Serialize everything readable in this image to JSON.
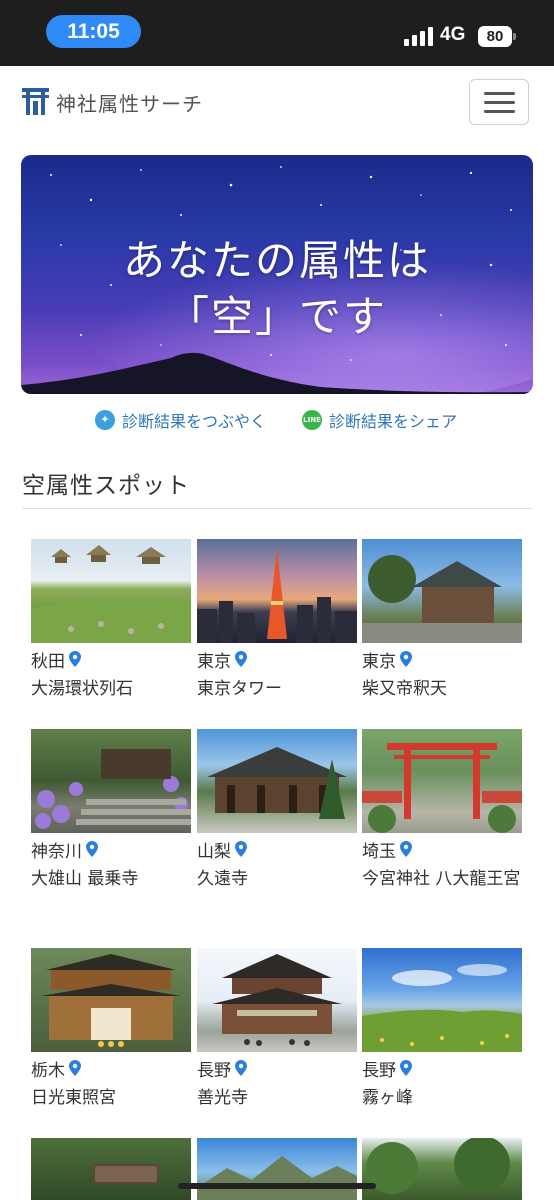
{
  "status_bar": {
    "time": "11:05",
    "network": "4G",
    "battery": "80"
  },
  "header": {
    "site_title": "神社属性サーチ"
  },
  "hero": {
    "line1": "あなたの属性は",
    "line2": "「空」です"
  },
  "share": {
    "twitter_label": "診断結果をつぶやく",
    "line_label": "診断結果をシェア",
    "line_icon_text": "LINE"
  },
  "section": {
    "title": "空属性スポット"
  },
  "spots": [
    {
      "pref": "秋田",
      "name": "大湯環状列石"
    },
    {
      "pref": "東京",
      "name": "東京タワー"
    },
    {
      "pref": "東京",
      "name": "柴又帝釈天"
    },
    {
      "pref": "神奈川",
      "name": "大雄山 最乗寺"
    },
    {
      "pref": "山梨",
      "name": "久遠寺"
    },
    {
      "pref": "埼玉",
      "name": "今宮神社 八大龍王宮"
    },
    {
      "pref": "栃木",
      "name": "日光東照宮"
    },
    {
      "pref": "長野",
      "name": "善光寺"
    },
    {
      "pref": "長野",
      "name": "霧ヶ峰"
    }
  ],
  "colors": {
    "accent_blue": "#2f76b8",
    "pin_blue": "#2a7de1",
    "line_green": "#3ab54a",
    "twitter_blue": "#3aa0e0"
  },
  "icons": {
    "twitter": "twitter-bird-icon",
    "line": "line-logo-icon",
    "pin": "map-pin-icon",
    "menu": "hamburger-icon"
  }
}
